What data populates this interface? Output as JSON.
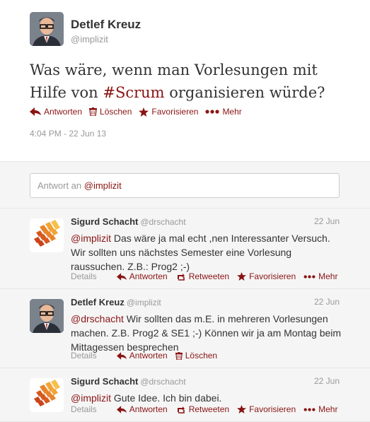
{
  "main_tweet": {
    "author": {
      "fullname": "Detlef Kreuz",
      "screenname": "@implizit"
    },
    "text_before": "Was wäre, wenn man Vorlesungen mit Hilfe von ",
    "hashtag": "#Scrum",
    "text_after": " organisieren würde?",
    "actions": {
      "reply": "Antworten",
      "delete": "Löschen",
      "favorite": "Favorisieren",
      "more": "Mehr"
    },
    "timestamp": "4:04 PM - 22 Jun 13"
  },
  "reply_box": {
    "prefix": "Antwort an ",
    "mention": "@implizit"
  },
  "replies": [
    {
      "fullname": "Sigurd Schacht",
      "screenname": "@drschacht",
      "date": "22 Jun",
      "mention": "@implizit",
      "text": " Das wäre ja mal echt ,nen Interessanter Versuch. Wir sollten uns nächstes Semester eine Vorlesung raussuchen. Z.B.: Prog2 ;-)",
      "details": "Details",
      "reply": "Antworten",
      "retweet": "Retweeten",
      "favorite": "Favorisieren",
      "more": "Mehr"
    },
    {
      "fullname": "Detlef Kreuz",
      "screenname": "@implizit",
      "date": "22 Jun",
      "mention": "@drschacht",
      "text": " Wir sollten das m.E. in mehreren Vorlesungen machen. Z.B. Prog2 & SE1 ;-) Können wir ja am Montag beim Mittagessen besprechen",
      "details": "Details",
      "reply": "Antworten",
      "delete": "Löschen"
    },
    {
      "fullname": "Sigurd Schacht",
      "screenname": "@drschacht",
      "date": "22 Jun",
      "mention": "@implizit",
      "text": " Gute Idee. Ich bin dabei.",
      "details": "Details",
      "reply": "Antworten",
      "retweet": "Retweeten",
      "favorite": "Favorisieren",
      "more": "Mehr"
    }
  ],
  "colors": {
    "accent": "#8a1414",
    "muted": "#999999",
    "reply_bg": "#f5f5f5"
  },
  "icons": [
    "reply-arrow-icon",
    "trash-icon",
    "star-icon",
    "more-dots-icon",
    "retweet-icon"
  ]
}
